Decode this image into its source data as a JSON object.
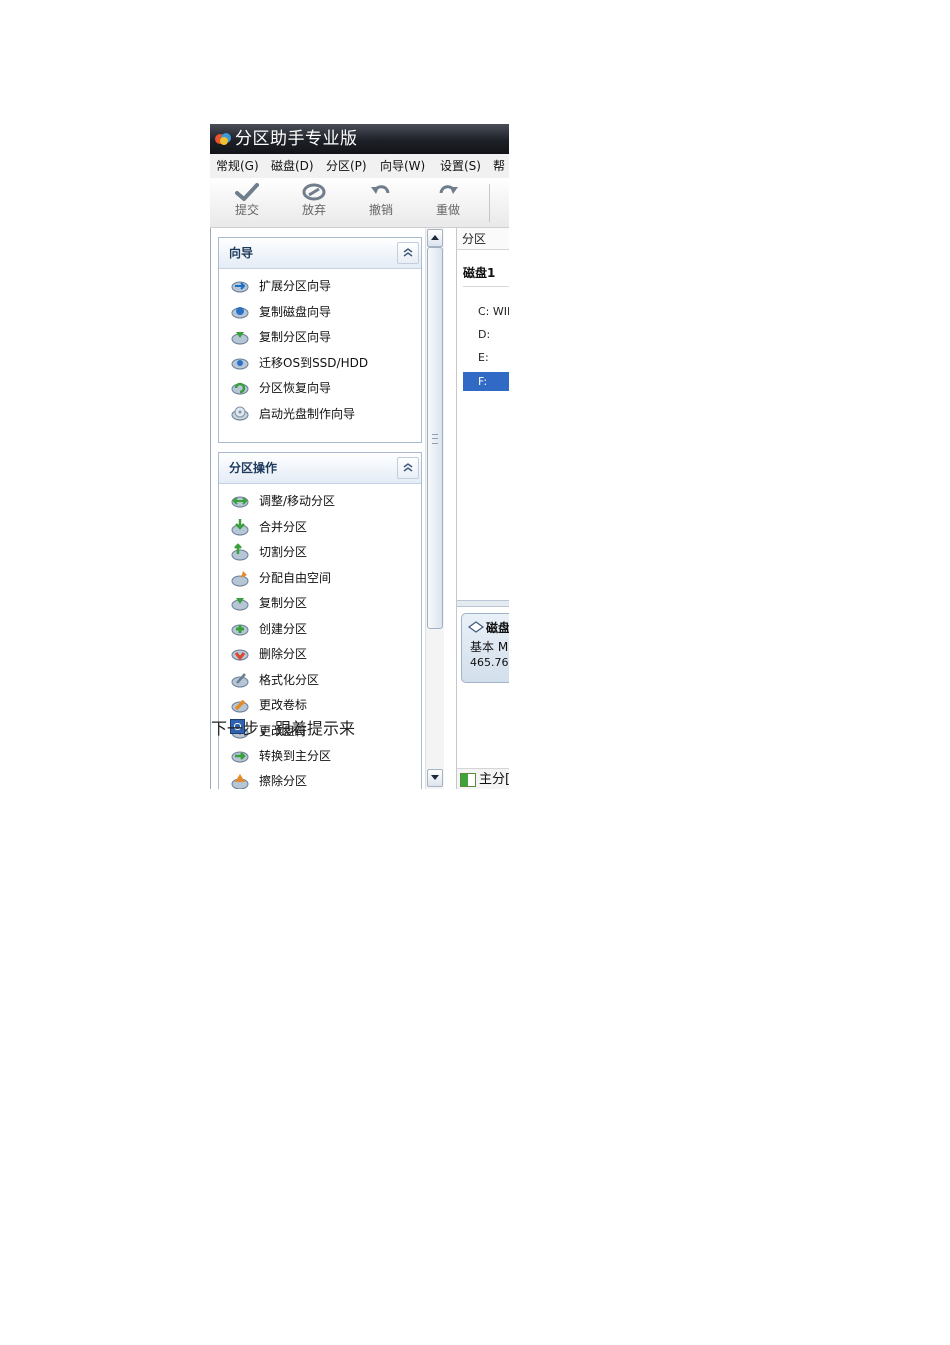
{
  "window": {
    "title": "分区助手专业版"
  },
  "menu": [
    {
      "label": "常规(G)"
    },
    {
      "label": "磁盘(D)"
    },
    {
      "label": "分区(P)"
    },
    {
      "label": "向导(W)"
    },
    {
      "label": "设置(S)"
    },
    {
      "label": "帮"
    }
  ],
  "toolbar": {
    "submit": "提交",
    "discard": "放弃",
    "undo": "撤销",
    "redo": "重做"
  },
  "wizard_panel": {
    "title": "向导",
    "items": [
      {
        "label": "扩展分区向导"
      },
      {
        "label": "复制磁盘向导"
      },
      {
        "label": "复制分区向导"
      },
      {
        "label": "迁移OS到SSD/HDD"
      },
      {
        "label": "分区恢复向导"
      },
      {
        "label": "启动光盘制作向导"
      }
    ]
  },
  "partition_panel": {
    "title": "分区操作",
    "items": [
      {
        "label": "调整/移动分区"
      },
      {
        "label": "合并分区"
      },
      {
        "label": "切割分区"
      },
      {
        "label": "分配自由空间"
      },
      {
        "label": "复制分区"
      },
      {
        "label": "创建分区"
      },
      {
        "label": "删除分区"
      },
      {
        "label": "格式化分区"
      },
      {
        "label": "更改卷标"
      },
      {
        "label": "更改盘符"
      },
      {
        "label": "转换到主分区"
      },
      {
        "label": "擦除分区"
      }
    ]
  },
  "partition_list": {
    "column_header": "分区",
    "disk_label": "磁盘1",
    "partitions": [
      {
        "label": "C: WII"
      },
      {
        "label": "D:"
      },
      {
        "label": "E:"
      },
      {
        "label": "F:"
      }
    ]
  },
  "disk_card": {
    "name": "磁盘",
    "type": "基本 M",
    "size": "465.76"
  },
  "legend": {
    "primary": "主分["
  },
  "caption": {
    "text": "下一步，跟着提示来"
  }
}
